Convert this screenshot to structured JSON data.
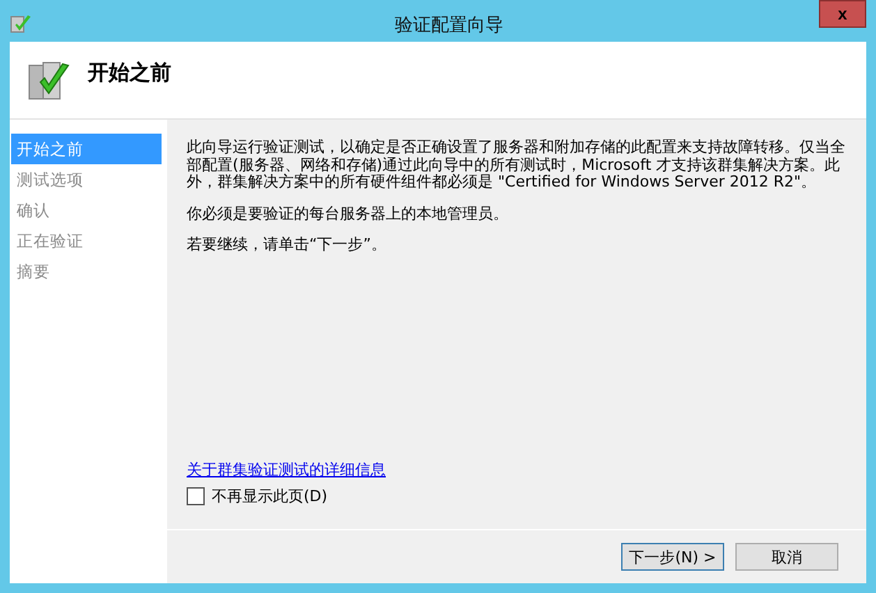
{
  "window": {
    "title": "验证配置向导",
    "close": "x"
  },
  "header": {
    "title": "开始之前"
  },
  "steps": [
    {
      "label": "开始之前",
      "selected": true
    },
    {
      "label": "测试选项",
      "selected": false
    },
    {
      "label": "确认",
      "selected": false
    },
    {
      "label": "正在验证",
      "selected": false
    },
    {
      "label": "摘要",
      "selected": false
    }
  ],
  "content": {
    "paragraphs": [
      "此向导运行验证测试，以确定是否正确设置了服务器和附加存储的此配置来支持故障转移。仅当全部配置(服务器、网络和存储)通过此向导中的所有测试时，Microsoft 才支持该群集解决方案。此外，群集解决方案中的所有硬件组件都必须是 \"Certified for Windows Server 2012 R2\"。",
      "你必须是要验证的每台服务器上的本地管理员。",
      "若要继续，请单击“下一步”。"
    ],
    "link": "关于群集验证测试的详细信息",
    "checkbox": {
      "label": "不再显示此页(D)",
      "checked": false
    }
  },
  "buttons": [
    {
      "label": "下一步(N) >",
      "kind": "default"
    },
    {
      "label": "取消",
      "kind": "normal"
    }
  ]
}
